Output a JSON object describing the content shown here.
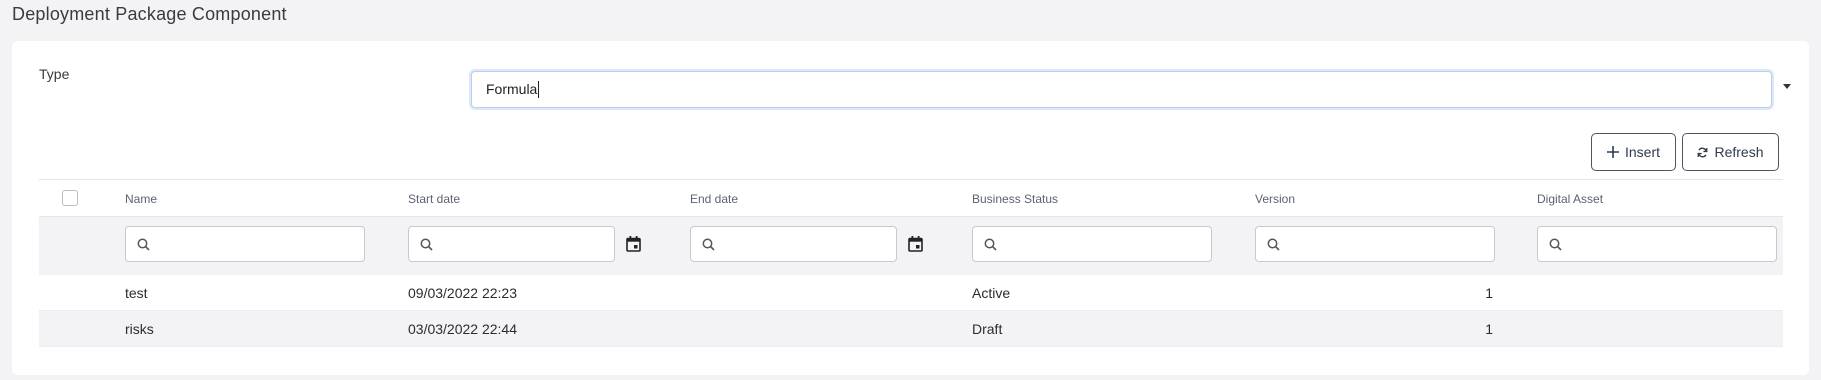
{
  "page": {
    "title": "Deployment Package Component"
  },
  "form": {
    "type_label": "Type",
    "type_value": "Formula"
  },
  "toolbar": {
    "insert_label": "Insert",
    "refresh_label": "Refresh"
  },
  "table": {
    "columns": [
      "Name",
      "Start date",
      "End date",
      "Business Status",
      "Version",
      "Digital Asset"
    ],
    "rows": [
      {
        "name": "test",
        "start_date": "09/03/2022 22:23",
        "end_date": "",
        "status": "Active",
        "version": "1",
        "asset": ""
      },
      {
        "name": "risks",
        "start_date": "03/03/2022 22:44",
        "end_date": "",
        "status": "Draft",
        "version": "1",
        "asset": ""
      }
    ]
  },
  "colors": {
    "accent_border": "#b9cfeb",
    "stripe": "#f3f3f6"
  },
  "icons": [
    "plus-icon",
    "refresh-icon",
    "search-icon",
    "calendar-icon",
    "chevron-down-icon"
  ]
}
